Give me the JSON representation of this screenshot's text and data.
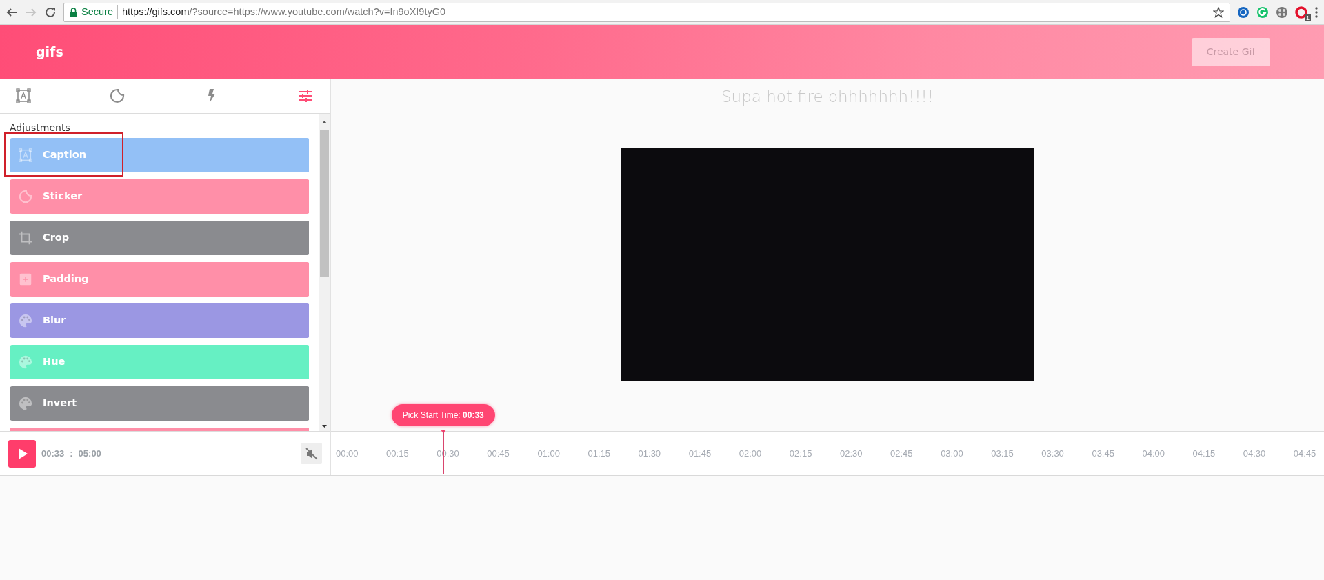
{
  "browser": {
    "secure_label": "Secure",
    "url_host": "https://gifs.com",
    "url_path": "/?source=https://www.youtube.com/watch?v=fn9oXI9tyG0",
    "extension_badge": "1"
  },
  "header": {
    "logo": "gifs",
    "create_button": {
      "label": "Create Gif",
      "disabled": true
    }
  },
  "tool_tabs": [
    {
      "kind": "caption",
      "selected": false
    },
    {
      "kind": "sticker",
      "selected": false
    },
    {
      "kind": "bolt",
      "selected": false
    },
    {
      "kind": "sliders",
      "selected": true
    }
  ],
  "panel": {
    "heading": "Adjustments",
    "items": [
      {
        "kind": "caption",
        "label": "Caption",
        "color": "#93c0f6",
        "highlighted": true
      },
      {
        "kind": "sticker",
        "label": "Sticker",
        "color": "#ff8fa8",
        "highlighted": false
      },
      {
        "kind": "crop",
        "label": "Crop",
        "color": "#8a8b8f",
        "highlighted": false
      },
      {
        "kind": "padding",
        "label": "Padding",
        "color": "#ff8fa8",
        "highlighted": false
      },
      {
        "kind": "palette",
        "label": "Blur",
        "color": "#9b97e3",
        "highlighted": false
      },
      {
        "kind": "palette",
        "label": "Hue",
        "color": "#66f0c3",
        "highlighted": false
      },
      {
        "kind": "palette",
        "label": "Invert",
        "color": "#8a8b8f",
        "highlighted": false
      },
      {
        "kind": "partial",
        "color": "#ff8fa8"
      }
    ]
  },
  "player": {
    "current_time": "00:33",
    "separator": ":",
    "total_time": "05:00",
    "muted": true
  },
  "stage": {
    "title": "Supa hot fire ohhhhhhh!!!!"
  },
  "timeline": {
    "tooltip": "Pick Start Time: **00:33**",
    "level": 0.113,
    "ticks": [
      "00:00",
      "00:15",
      "00:30",
      "00:45",
      "01:00",
      "01:15",
      "01:30",
      "01:45",
      "02:00",
      "02:15",
      "02:30",
      "02:45",
      "03:00",
      "03:15",
      "03:30",
      "03:45",
      "04:00",
      "04:15",
      "04:30",
      "04:45"
    ]
  }
}
